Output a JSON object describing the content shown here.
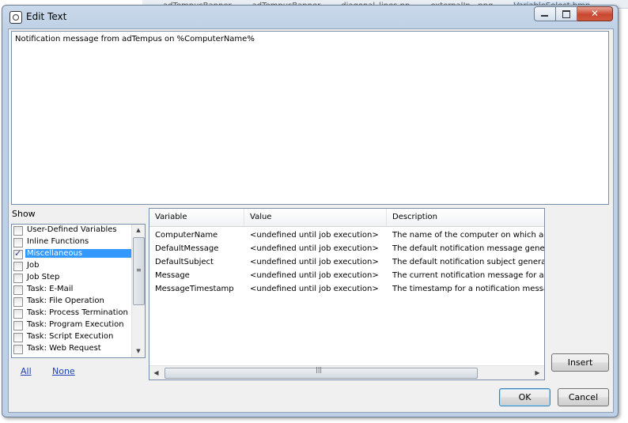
{
  "background_tabs": [
    "adTempusBanner",
    "adTempusBanner",
    "diagonal_lines.pn",
    "externalIn...png",
    "VariableSelect.bmp"
  ],
  "window": {
    "title": "Edit Text",
    "caption": {
      "minimize": "",
      "maximize": "",
      "close": "✕"
    }
  },
  "editor": {
    "text": "Notification message from adTempus on %ComputerName%"
  },
  "show": {
    "label": "Show",
    "items": [
      {
        "label": "User-Defined Variables",
        "checked": false,
        "selected": false
      },
      {
        "label": "Inline Functions",
        "checked": false,
        "selected": false
      },
      {
        "label": "Miscellaneous",
        "checked": true,
        "selected": true
      },
      {
        "label": "Job",
        "checked": false,
        "selected": false
      },
      {
        "label": "Job Step",
        "checked": false,
        "selected": false
      },
      {
        "label": "Task: E-Mail",
        "checked": false,
        "selected": false
      },
      {
        "label": "Task: File Operation",
        "checked": false,
        "selected": false
      },
      {
        "label": "Task: Process Termination",
        "checked": false,
        "selected": false
      },
      {
        "label": "Task: Program Execution",
        "checked": false,
        "selected": false
      },
      {
        "label": "Task: Script Execution",
        "checked": false,
        "selected": false
      },
      {
        "label": "Task: Web Request",
        "checked": false,
        "selected": false
      }
    ],
    "links": {
      "all": "All",
      "none": "None"
    }
  },
  "variables": {
    "columns": [
      "Variable",
      "Value",
      "Description"
    ],
    "rows": [
      [
        "ComputerName",
        "<undefined until job execution>",
        "The name of the computer on which adT"
      ],
      [
        "DefaultMessage",
        "<undefined until job execution>",
        "The default notification message generat"
      ],
      [
        "DefaultSubject",
        "<undefined until job execution>",
        "The default notification subject generate"
      ],
      [
        "Message",
        "<undefined until job execution>",
        "The current notification message for a no"
      ],
      [
        "MessageTimestamp",
        "<undefined until job execution>",
        "The timestamp for a notification message"
      ]
    ]
  },
  "buttons": {
    "insert": "Insert",
    "ok": "OK",
    "cancel": "Cancel"
  },
  "colors": {
    "selection": "#3399ff",
    "link": "#1d3fb8",
    "titlebar": "#c9d8ea",
    "close_button": "#c9462f"
  }
}
